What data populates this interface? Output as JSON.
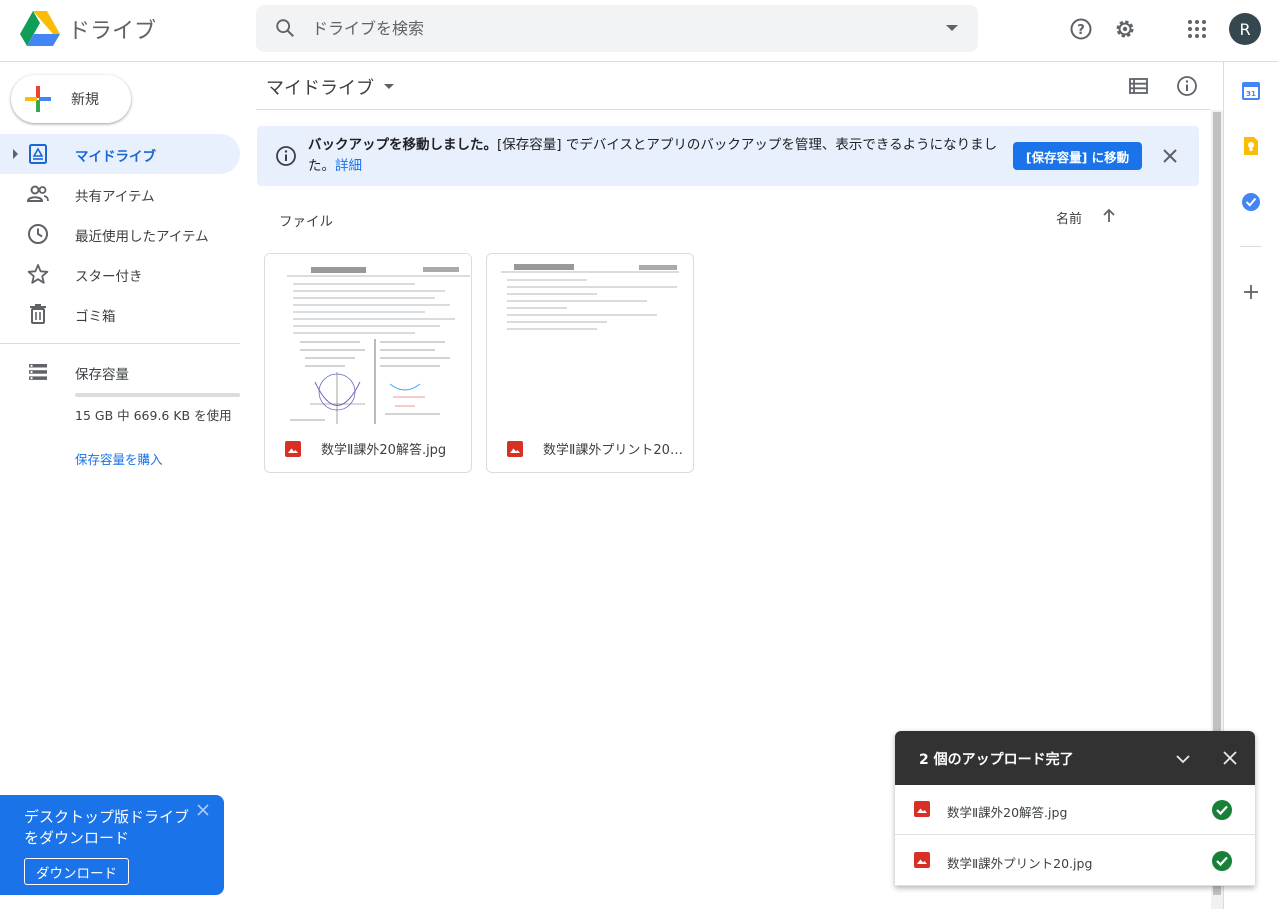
{
  "header": {
    "app_title": "ドライブ",
    "search_placeholder": "ドライブを検索",
    "avatar_initial": "R"
  },
  "sidebar": {
    "new_label": "新規",
    "items": [
      {
        "label": "マイドライブ",
        "icon": "my-drive-icon",
        "active": true
      },
      {
        "label": "共有アイテム",
        "icon": "shared-people-icon",
        "active": false
      },
      {
        "label": "最近使用したアイテム",
        "icon": "clock-icon",
        "active": false
      },
      {
        "label": "スター付き",
        "icon": "star-icon",
        "active": false
      },
      {
        "label": "ゴミ箱",
        "icon": "trash-icon",
        "active": false
      }
    ],
    "storage": {
      "label": "保存容量",
      "usage": "15 GB 中 669.6 KB を使用",
      "buy": "保存容量を購入"
    }
  },
  "promo": {
    "text": "デスクトップ版ドライブをダウンロード",
    "button": "ダウンロード"
  },
  "main": {
    "title": "マイドライブ",
    "banner": {
      "bold": "バックアップを移動しました。",
      "text": "[保存容量] でデバイスとアプリのバックアップを管理、表示できるようになりました。",
      "link": "詳細",
      "button": "[保存容量] に移動"
    },
    "files_heading": "ファイル",
    "sort_label": "名前",
    "files": [
      {
        "name": "数学Ⅱ課外20解答.jpg"
      },
      {
        "name": "数学Ⅱ課外プリント20.jpg"
      }
    ]
  },
  "upload": {
    "title": "2 個のアップロード完了",
    "items": [
      {
        "name": "数学Ⅱ課外20解答.jpg",
        "status": "complete"
      },
      {
        "name": "数学Ⅱ課外プリント20.jpg",
        "status": "complete"
      }
    ]
  },
  "colors": {
    "accent": "#1a73e8",
    "active_bg": "#e8f0fe",
    "image_icon": "#d93025",
    "success": "#188038"
  }
}
